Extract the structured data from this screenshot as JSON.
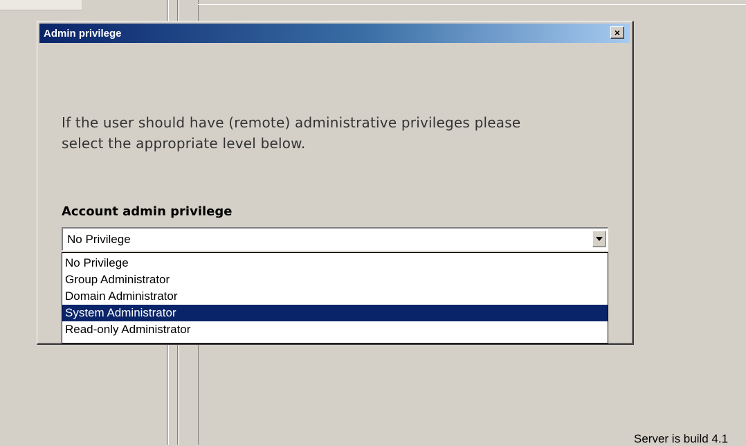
{
  "dialog": {
    "title": "Admin privilege",
    "close_symbol": "×",
    "instruction_line1": "If the user should have (remote) administrative privileges please",
    "instruction_line2": "select the appropriate level below.",
    "field_label": "Account admin privilege",
    "combo_value": "No Privilege",
    "options": [
      "No Privilege",
      "Group Administrator",
      "Domain Administrator",
      "System Administrator",
      "Read-only Administrator"
    ],
    "highlighted_option": "System Administrator"
  },
  "status": {
    "server_build_text": "Server is build 4.1"
  },
  "colors": {
    "title_bar_start": "#0a246a",
    "title_bar_end": "#a6caf0",
    "selection": "#0a246a",
    "window_face": "#d4d0c8"
  }
}
